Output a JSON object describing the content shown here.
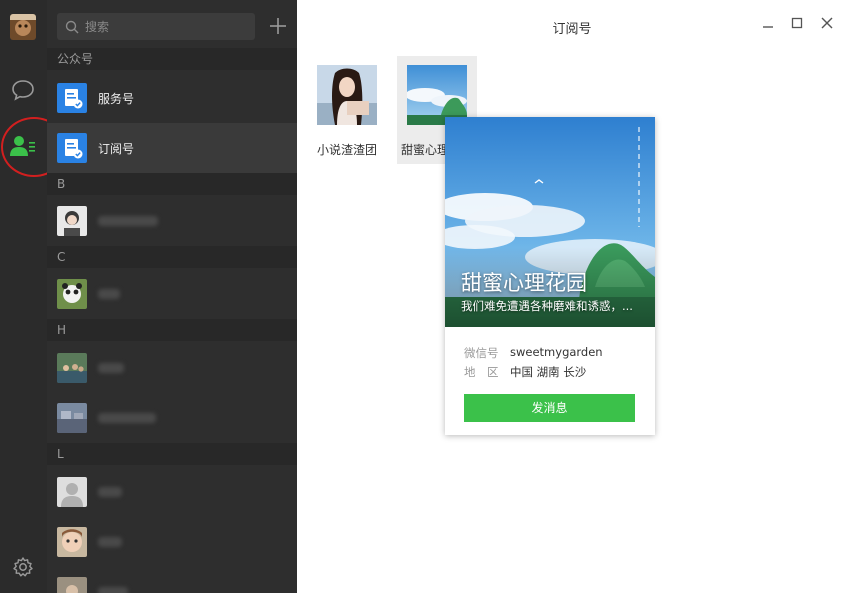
{
  "window": {
    "title": "订阅号"
  },
  "search": {
    "placeholder": "搜索"
  },
  "sections": {
    "official": "公众号",
    "b": "B",
    "c": "C",
    "h": "H",
    "l": "L"
  },
  "official_items": [
    {
      "label": "服务号"
    },
    {
      "label": "订阅号"
    }
  ],
  "accounts": [
    {
      "name": "小说渣渣团"
    },
    {
      "name": "甜蜜心理花园"
    }
  ],
  "card": {
    "cover_title": "甜蜜心理花园",
    "cover_desc": "我们难免遭遇各种磨难和诱惑，...",
    "wechat_id_label": "微信号",
    "wechat_id": "sweetmygarden",
    "region_label": "地　区",
    "region": "中国 湖南 长沙",
    "send_label": "发消息"
  },
  "colors": {
    "accent_green": "#3bc14a",
    "sidebar_bg": "#2e2e2e",
    "rail_bg": "#2b2b2b",
    "highlight_red": "#d21f1f"
  }
}
